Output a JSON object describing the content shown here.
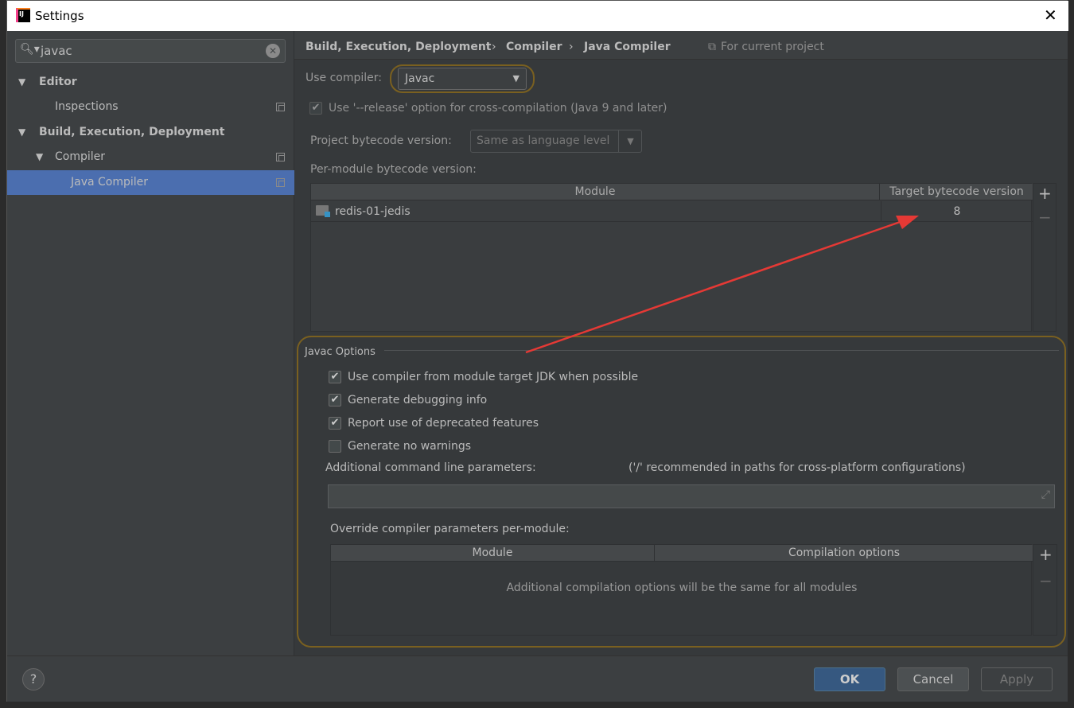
{
  "window": {
    "title": "Settings",
    "close_icon": "close-icon"
  },
  "search": {
    "value": "javac"
  },
  "tree": [
    {
      "label": "Editor",
      "bold": true
    },
    {
      "label": "Inspections"
    },
    {
      "label": "Build, Execution, Deployment",
      "bold": true
    },
    {
      "label": "Compiler"
    },
    {
      "label": "Java Compiler",
      "selected": true
    }
  ],
  "breadcrumb": {
    "items": [
      "Build, Execution, Deployment",
      "Compiler",
      "Java Compiler"
    ],
    "scope": "For current project"
  },
  "compiler": {
    "label": "Use compiler:",
    "value": "Javac"
  },
  "release_option": {
    "label": "Use '--release' option for cross-compilation (Java 9 and later)",
    "checked": true
  },
  "project_bytecode": {
    "label": "Project bytecode version:",
    "value": "Same as language level"
  },
  "per_module": {
    "label": "Per-module bytecode version:",
    "columns": [
      "Module",
      "Target bytecode version"
    ],
    "rows": [
      {
        "module": "redis-01-jedis",
        "target": "8"
      }
    ]
  },
  "javac": {
    "title": "Javac Options",
    "options": [
      {
        "label": "Use compiler from module target JDK when possible",
        "checked": true
      },
      {
        "label": "Generate debugging info",
        "checked": true
      },
      {
        "label": "Report use of deprecated features",
        "checked": true
      },
      {
        "label": "Generate no warnings",
        "checked": false
      }
    ],
    "cmd_label": "Additional command line parameters:",
    "cmd_hint": "('/' recommended in paths for cross-platform configurations)",
    "cmd_value": "",
    "override_label": "Override compiler parameters per-module:",
    "override_columns": [
      "Module",
      "Compilation options"
    ],
    "override_empty": "Additional compilation options will be the same for all modules"
  },
  "buttons": {
    "ok": "OK",
    "cancel": "Cancel",
    "apply": "Apply",
    "help": "?"
  },
  "colors": {
    "accent": "#4b6eaf",
    "annotation": "#e53935",
    "highlight": "#8a6d1e"
  }
}
